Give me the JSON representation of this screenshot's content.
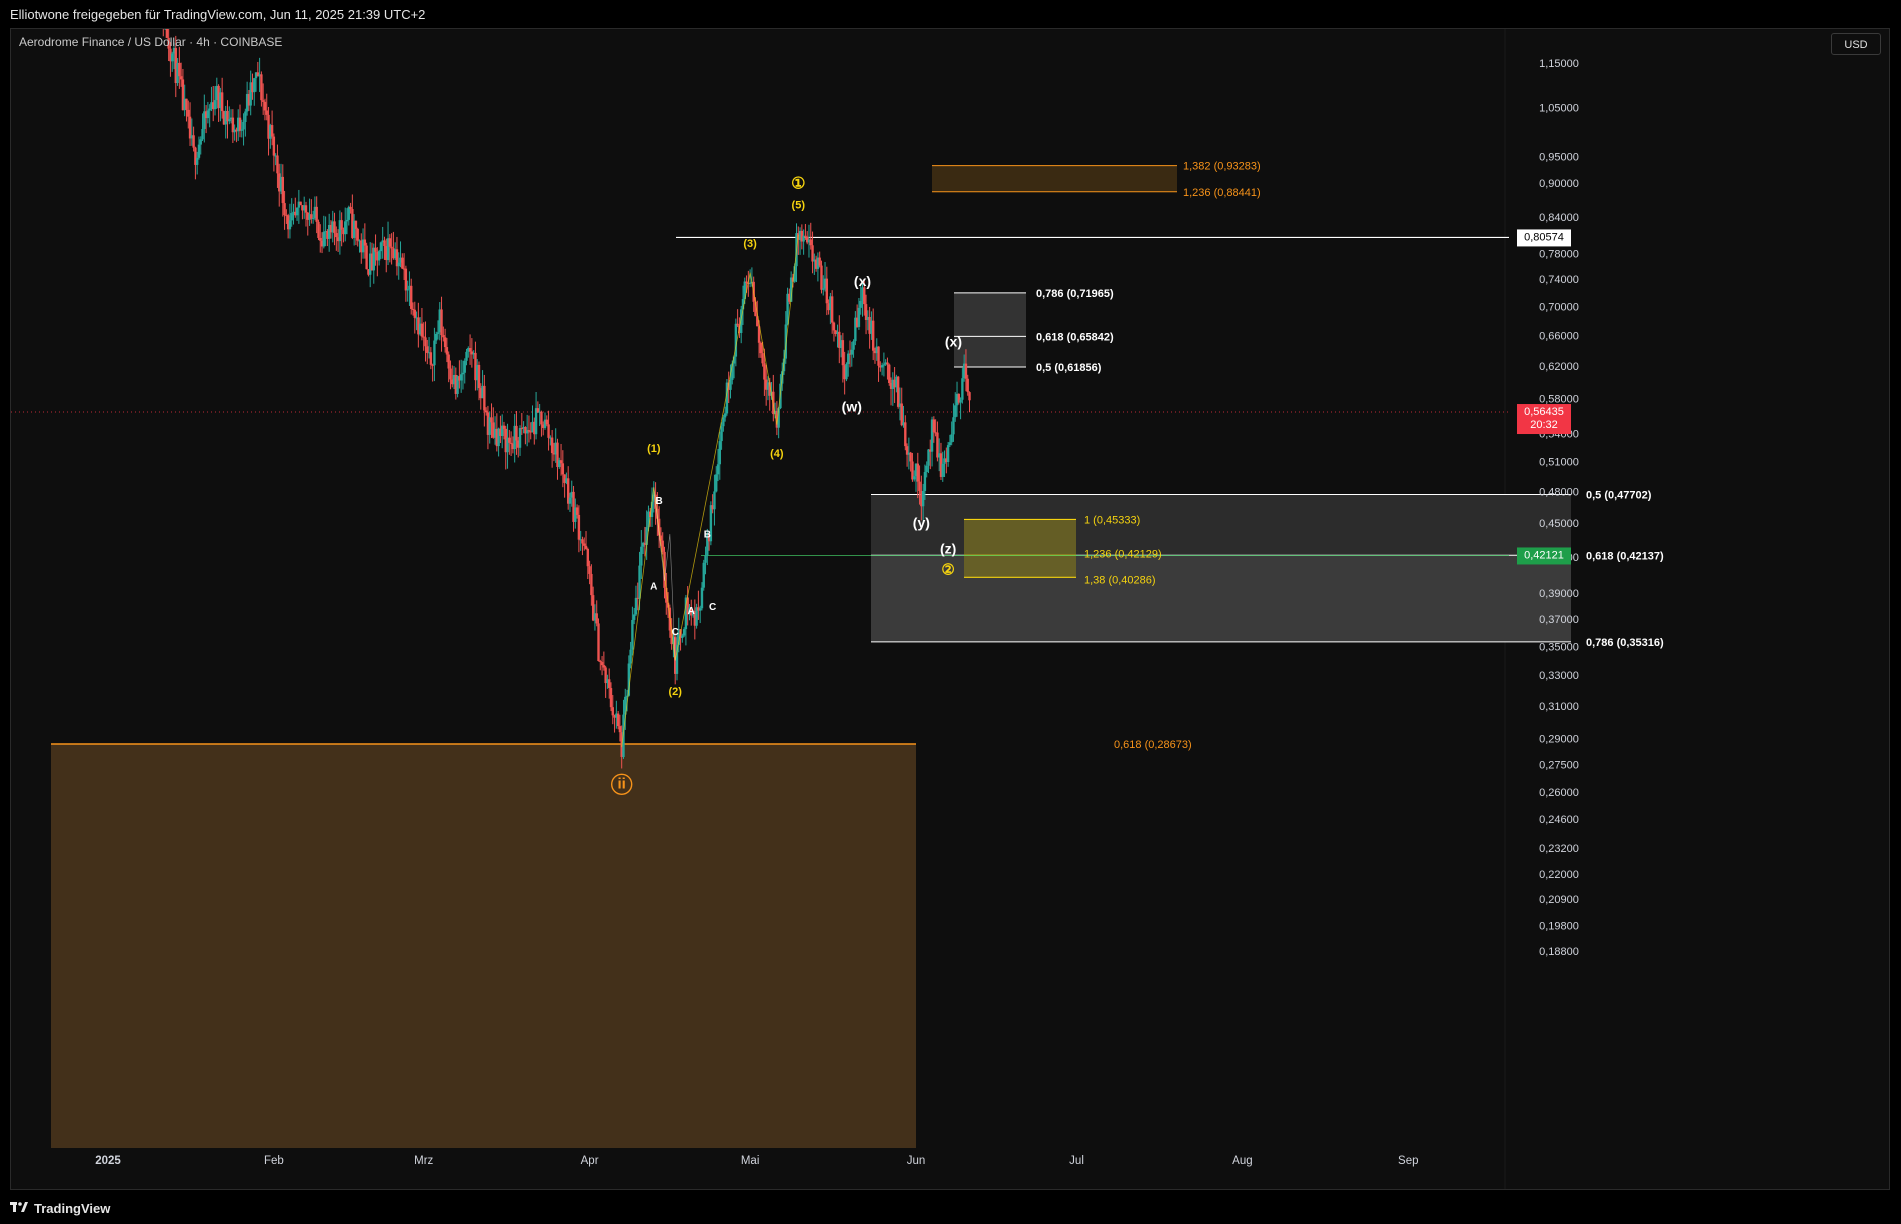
{
  "header": {
    "shared_text": "Elliotwone freigegeben für TradingView.com, Jun 11, 2025 21:39 UTC+2"
  },
  "chart_header": {
    "symbol_text": "Aerodrome Finance / US Dollar · 4h · COINBASE",
    "currency_button": "USD"
  },
  "footer": {
    "logo_text": "TradingView"
  },
  "colors": {
    "background": "#0e0e0e",
    "up_candle": "#26a69a",
    "down_candle": "#ef5350",
    "orange_zone": "#43301a",
    "orange_text": "#f7931a",
    "yellow_wave": "#f5d30f",
    "white_wave": "#ffffff",
    "current_price_bg": "#f23645",
    "green_level_bg": "#1e9e4a",
    "gray_zone": "#3a3a3a"
  },
  "chart_data": {
    "type": "candlestick",
    "symbol": "Aerodrome Finance / US Dollar",
    "interval": "4h",
    "exchange": "COINBASE",
    "y_scale": "log",
    "y_axis_ticks": [
      "1,15000",
      "1,05000",
      "0,95000",
      "0,90000",
      "0,84000",
      "0,78000",
      "0,74000",
      "0,70000",
      "0,66000",
      "0,62000",
      "0,58000",
      "0,54000",
      "0,51000",
      "0,48000",
      "0,45000",
      "0,42000",
      "0,39000",
      "0,37000",
      "0,35000",
      "0,33000",
      "0,31000",
      "0,29000",
      "0,27500",
      "0,26000",
      "0,24600",
      "0,23200",
      "0,22000",
      "0,20900",
      "0,19800",
      "0,18800"
    ],
    "x_axis_ticks": [
      "2025",
      "Feb",
      "Mrz",
      "Apr",
      "Mai",
      "Jun",
      "Jul",
      "Aug",
      "Sep"
    ],
    "price_path": [
      {
        "t": "2025-01-09",
        "p": 1.4
      },
      {
        "t": "2025-01-14",
        "p": 1.12
      },
      {
        "t": "2025-01-17",
        "p": 0.95
      },
      {
        "t": "2025-01-21",
        "p": 1.08
      },
      {
        "t": "2025-01-25",
        "p": 1.0
      },
      {
        "t": "2025-01-29",
        "p": 1.12
      },
      {
        "t": "2025-02-01",
        "p": 0.96
      },
      {
        "t": "2025-02-04",
        "p": 0.82
      },
      {
        "t": "2025-02-07",
        "p": 0.86
      },
      {
        "t": "2025-02-11",
        "p": 0.8
      },
      {
        "t": "2025-02-15",
        "p": 0.84
      },
      {
        "t": "2025-02-19",
        "p": 0.76
      },
      {
        "t": "2025-02-23",
        "p": 0.8
      },
      {
        "t": "2025-02-27",
        "p": 0.71
      },
      {
        "t": "2025-03-02",
        "p": 0.62
      },
      {
        "t": "2025-03-04",
        "p": 0.68
      },
      {
        "t": "2025-03-07",
        "p": 0.59
      },
      {
        "t": "2025-03-10",
        "p": 0.64
      },
      {
        "t": "2025-03-13",
        "p": 0.55
      },
      {
        "t": "2025-03-17",
        "p": 0.53
      },
      {
        "t": "2025-03-20",
        "p": 0.54
      },
      {
        "t": "2025-03-23",
        "p": 0.56
      },
      {
        "t": "2025-03-27",
        "p": 0.5
      },
      {
        "t": "2025-03-31",
        "p": 0.43
      },
      {
        "t": "2025-04-03",
        "p": 0.34
      },
      {
        "t": "2025-04-06",
        "p": 0.3
      },
      {
        "t": "2025-04-07",
        "p": 0.285
      },
      {
        "t": "2025-04-09",
        "p": 0.36
      },
      {
        "t": "2025-04-11",
        "p": 0.43
      },
      {
        "t": "2025-04-13",
        "p": 0.484
      },
      {
        "t": "2025-04-15",
        "p": 0.4
      },
      {
        "t": "2025-04-17",
        "p": 0.34
      },
      {
        "t": "2025-04-19",
        "p": 0.38
      },
      {
        "t": "2025-04-21",
        "p": 0.37
      },
      {
        "t": "2025-04-23",
        "p": 0.43
      },
      {
        "t": "2025-04-25",
        "p": 0.52
      },
      {
        "t": "2025-04-28",
        "p": 0.65
      },
      {
        "t": "2025-05-01",
        "p": 0.75
      },
      {
        "t": "2025-05-03",
        "p": 0.64
      },
      {
        "t": "2025-05-06",
        "p": 0.55
      },
      {
        "t": "2025-05-08",
        "p": 0.7
      },
      {
        "t": "2025-05-10",
        "p": 0.81
      },
      {
        "t": "2025-05-13",
        "p": 0.77
      },
      {
        "t": "2025-05-16",
        "p": 0.7
      },
      {
        "t": "2025-05-19",
        "p": 0.61
      },
      {
        "t": "2025-05-22",
        "p": 0.72
      },
      {
        "t": "2025-05-25",
        "p": 0.62
      },
      {
        "t": "2025-05-28",
        "p": 0.6
      },
      {
        "t": "2025-05-31",
        "p": 0.51
      },
      {
        "t": "2025-06-02",
        "p": 0.48
      },
      {
        "t": "2025-06-04",
        "p": 0.54
      },
      {
        "t": "2025-06-06",
        "p": 0.5
      },
      {
        "t": "2025-06-08",
        "p": 0.55
      },
      {
        "t": "2025-06-10",
        "p": 0.62
      },
      {
        "t": "2025-06-11",
        "p": 0.564
      }
    ],
    "current_price": {
      "label": "0,56435",
      "countdown": "20:32",
      "value": 0.56435
    },
    "horizontal_levels": [
      {
        "label": "0,80574",
        "value": 0.80574,
        "color": "#ffffff"
      },
      {
        "label": "0,42121",
        "value": 0.42121,
        "color": "#1e9e4a"
      }
    ],
    "fib_labels": [
      {
        "text": "1,382 (0,93283)",
        "value": 0.93283,
        "color": "#f7931a"
      },
      {
        "text": "1,236 (0,88441)",
        "value": 0.88441,
        "color": "#f7931a"
      },
      {
        "text": "0,786 (0,71965)",
        "value": 0.71965,
        "color": "#ffffff"
      },
      {
        "text": "0,618 (0,65842)",
        "value": 0.65842,
        "color": "#ffffff"
      },
      {
        "text": "0,5 (0,61856)",
        "value": 0.61856,
        "color": "#ffffff"
      },
      {
        "text": "0,5 (0,47702)",
        "value": 0.47702,
        "color": "#ffffff"
      },
      {
        "text": "1 (0,45333)",
        "value": 0.45333,
        "color": "#f5d30f"
      },
      {
        "text": "1,236 (0,42129)",
        "value": 0.42129,
        "color": "#f5d30f"
      },
      {
        "text": "0,618 (0,42137)",
        "value": 0.42137,
        "color": "#ffffff"
      },
      {
        "text": "1,38 (0,40286)",
        "value": 0.40286,
        "color": "#f5d30f"
      },
      {
        "text": "0,786 (0,35316)",
        "value": 0.35316,
        "color": "#ffffff"
      },
      {
        "text": "0,618 (0,28673)",
        "value": 0.28673,
        "color": "#f7931a"
      }
    ],
    "wave_labels": [
      {
        "text": "(1)",
        "color": "#f5d30f"
      },
      {
        "text": "(2)",
        "color": "#f5d30f"
      },
      {
        "text": "(3)",
        "color": "#f5d30f"
      },
      {
        "text": "(4)",
        "color": "#f5d30f"
      },
      {
        "text": "(5)",
        "color": "#f5d30f"
      },
      {
        "text": "①",
        "color": "#f5d30f"
      },
      {
        "text": "②",
        "color": "#f5d30f"
      },
      {
        "text": "ii",
        "color": "#f7931a"
      },
      {
        "text": "(w)",
        "color": "#ffffff"
      },
      {
        "text": "(x)",
        "color": "#ffffff"
      },
      {
        "text": "(x)",
        "color": "#ffffff"
      },
      {
        "text": "(y)",
        "color": "#ffffff"
      },
      {
        "text": "(z)",
        "color": "#ffffff"
      },
      {
        "text": "A",
        "color": "#ffffff"
      },
      {
        "text": "B",
        "color": "#ffffff"
      },
      {
        "text": "C",
        "color": "#ffffff"
      },
      {
        "text": "A",
        "color": "#ffffff"
      },
      {
        "text": "B",
        "color": "#ffffff"
      },
      {
        "text": "C",
        "color": "#ffffff"
      }
    ]
  }
}
